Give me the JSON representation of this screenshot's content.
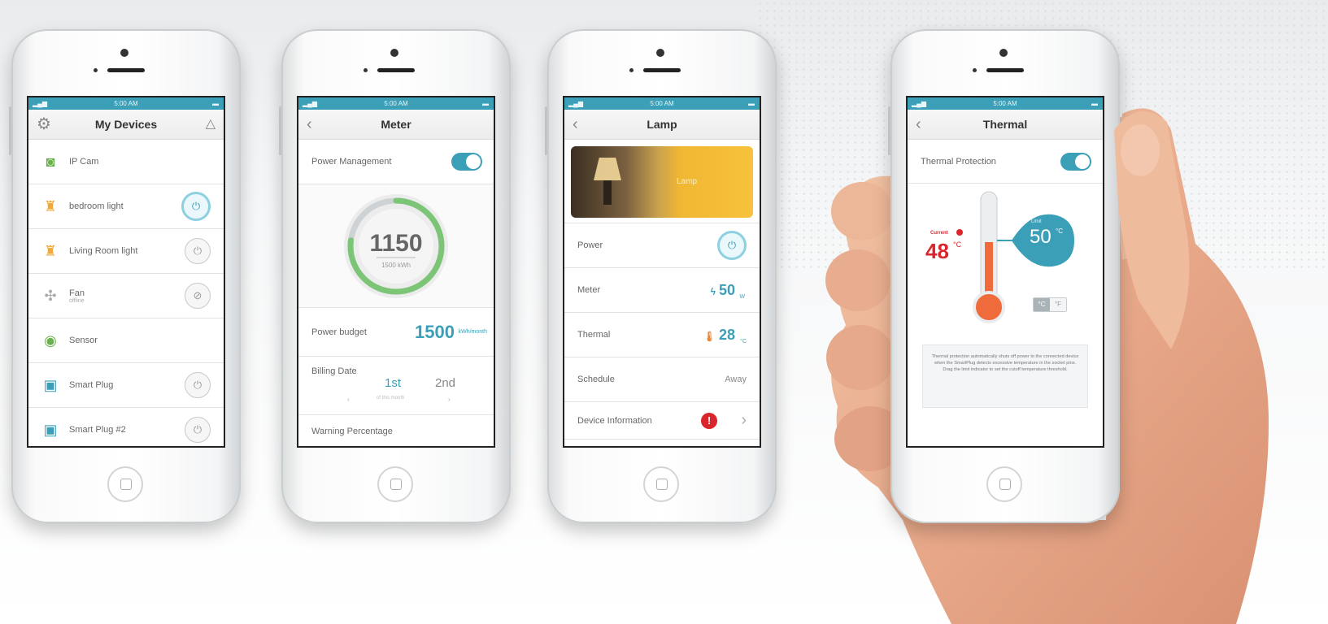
{
  "status_time": "5:00 AM",
  "screen1": {
    "title": "My Devices",
    "devices": [
      {
        "name": "IP Cam",
        "sub": "",
        "icon": "camera-icon",
        "power": ""
      },
      {
        "name": "bedroom light",
        "sub": "",
        "icon": "lamp-icon",
        "power": "on"
      },
      {
        "name": "Living Room light",
        "sub": "",
        "icon": "lamp-icon",
        "power": "off"
      },
      {
        "name": "Fan",
        "sub": "offline",
        "icon": "fan-icon",
        "power": "disabled"
      },
      {
        "name": "Sensor",
        "sub": "",
        "icon": "sensor-icon",
        "power": ""
      },
      {
        "name": "Smart Plug",
        "sub": "",
        "icon": "plug-icon",
        "power": "off"
      },
      {
        "name": "Smart Plug #2",
        "sub": "",
        "icon": "plug-icon",
        "power": "off"
      }
    ]
  },
  "screen2": {
    "title": "Meter",
    "power_mgmt_label": "Power Management",
    "gauge_value": "1150",
    "gauge_sub": "1500 kWh",
    "gauge_fraction": 0.77,
    "budget_label": "Power budget",
    "budget_value": "1500",
    "budget_unit": "kWh/month",
    "billing_label": "Billing Date",
    "billing_day1": "1st",
    "billing_day2": "2nd",
    "billing_hint": "of this month",
    "warning_label": "Warning Percentage"
  },
  "screen3": {
    "title": "Lamp",
    "banner_text": "Lamp",
    "rows": {
      "power": "Power",
      "meter": "Meter",
      "meter_value": "50",
      "meter_unit": "W",
      "thermal": "Thermal",
      "thermal_value": "28",
      "thermal_unit": "°C",
      "schedule": "Schedule",
      "schedule_value": "Away",
      "device_info": "Device Information"
    }
  },
  "screen4": {
    "title": "Thermal",
    "protection_label": "Thermal Protection",
    "current_label": "Current",
    "current_value": "48",
    "limit_label": "Limit",
    "limit_value": "50",
    "unit": "°C",
    "unit_c": "°C",
    "unit_f": "°F",
    "description": "Thermal protection automatically shuts off power to the connected device when the SmartPlug detects excessive temperature in the socket pins. Drag the limit indicator to set the cutoff temperature threshold."
  },
  "colors": {
    "accent": "#3a9fb7",
    "gauge_green": "#7cc576",
    "alert_red": "#d9252b",
    "thermo_orange": "#ef6b3b"
  }
}
